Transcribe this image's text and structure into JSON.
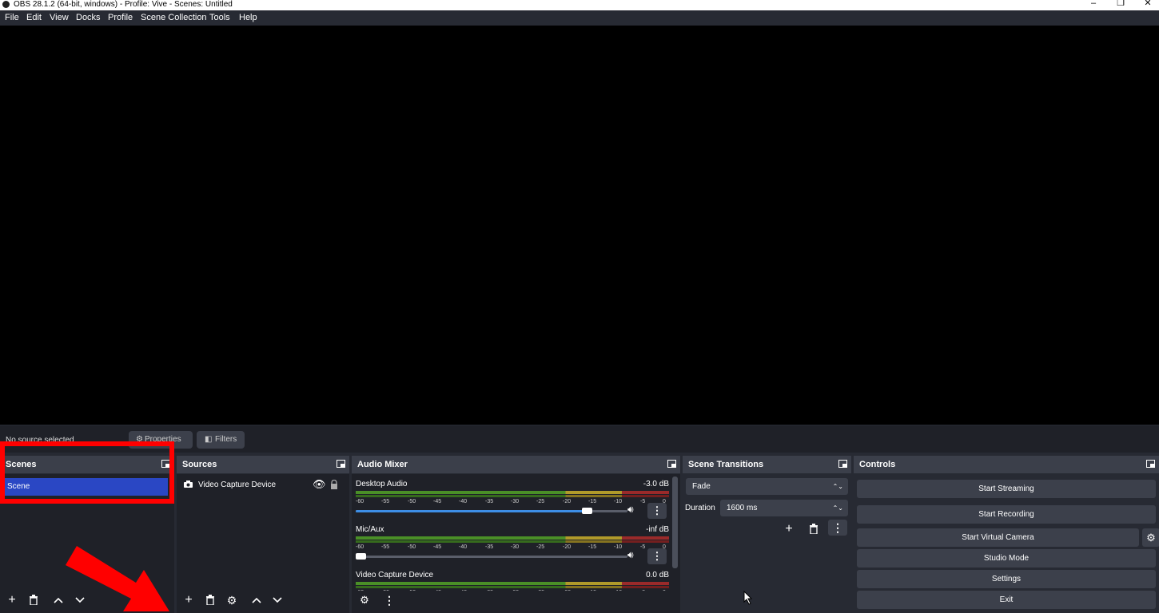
{
  "window": {
    "title": "OBS 28.1.2 (64-bit, windows) - Profile: Vive - Scenes: Untitled"
  },
  "menu": [
    "File",
    "Edit",
    "View",
    "Docks",
    "Profile",
    "Scene Collection",
    "Tools",
    "Help"
  ],
  "preview_bar": {
    "no_source": "No source selected",
    "properties": "Properties",
    "filters": "Filters"
  },
  "scenes": {
    "title": "Scenes",
    "items": [
      "Scene"
    ]
  },
  "sources": {
    "title": "Sources",
    "items": [
      {
        "name": "Video Capture Device"
      }
    ]
  },
  "audio_mixer": {
    "title": "Audio Mixer",
    "channels": [
      {
        "name": "Desktop Audio",
        "db": "-3.0 dB",
        "volume": 0.85
      },
      {
        "name": "Mic/Aux",
        "db": "-inf dB",
        "volume": 0.0
      },
      {
        "name": "Video Capture Device",
        "db": "0.0 dB",
        "volume": 1.0
      }
    ],
    "ticks": [
      "-60",
      "-55",
      "-50",
      "-45",
      "-40",
      "-35",
      "-30",
      "-25",
      "-20",
      "-15",
      "-10",
      "-5",
      "0"
    ]
  },
  "transitions": {
    "title": "Scene Transitions",
    "selected": "Fade",
    "duration_label": "Duration",
    "duration": "1600 ms"
  },
  "controls": {
    "title": "Controls",
    "start_streaming": "Start Streaming",
    "start_recording": "Start Recording",
    "start_virtual_camera": "Start Virtual Camera",
    "studio_mode": "Studio Mode",
    "settings": "Settings",
    "exit": "Exit"
  },
  "colors": {
    "accent": "#2a47c4",
    "highlight": "#ff0000",
    "panel": "#272a33",
    "dock_body": "#1f2128"
  }
}
